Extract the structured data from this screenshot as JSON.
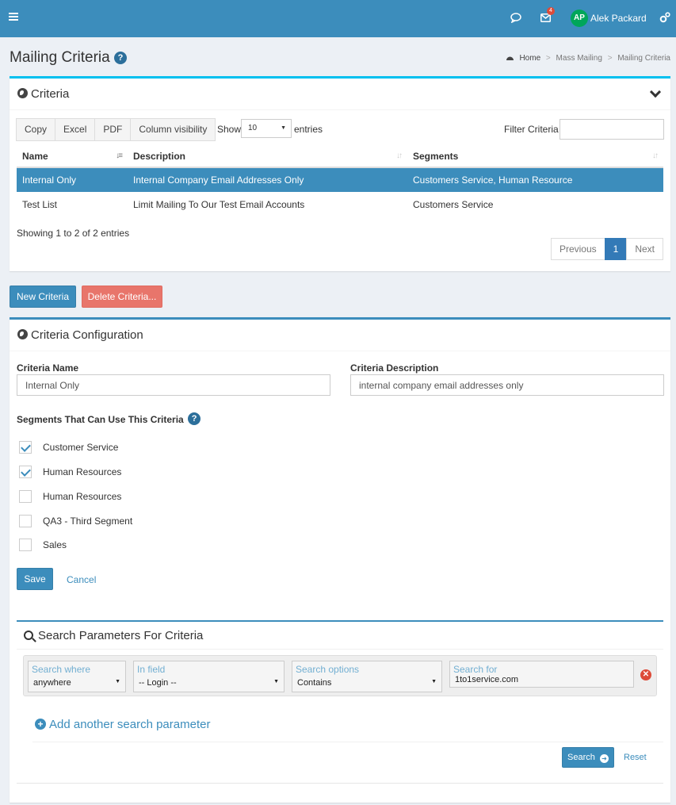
{
  "topbar": {
    "badge_count": "4",
    "avatar_initials": "AP",
    "user_name": "Alek Packard"
  },
  "page": {
    "title": "Mailing Criteria",
    "breadcrumb": [
      "Home",
      "Mass Mailing",
      "Mailing Criteria"
    ]
  },
  "criteria_box": {
    "title": "Criteria",
    "export_buttons": [
      "Copy",
      "Excel",
      "PDF",
      "Column visibility"
    ],
    "show_label": "Show",
    "page_length": "10",
    "entries_label": "entries",
    "filter_label": "Filter Criteria",
    "filter_value": "",
    "columns": [
      "Name",
      "Description",
      "Segments"
    ],
    "rows": [
      {
        "name": "Internal Only",
        "description": "Internal Company Email Addresses Only",
        "segments": "Customers Service, Human Resource",
        "selected": true
      },
      {
        "name": "Test List",
        "description": "Limit Mailing To Our Test Email Accounts",
        "segments": "Customers Service",
        "selected": false
      }
    ],
    "info": "Showing 1 to 2 of 2 entries",
    "pager": {
      "previous": "Previous",
      "current": "1",
      "next": "Next"
    }
  },
  "actions": {
    "new": "New Criteria",
    "delete": "Delete Criteria..."
  },
  "config": {
    "title": "Criteria Configuration",
    "name_label": "Criteria Name",
    "name_value": "Internal Only",
    "description_label": "Criteria Description",
    "description_value": "internal company email addresses only",
    "segments_label": "Segments That Can Use This Criteria",
    "segments": [
      {
        "label": "Customer Service",
        "checked": true
      },
      {
        "label": "Human Resources",
        "checked": true
      },
      {
        "label": "Human Resources",
        "checked": false
      },
      {
        "label": "QA3 - Third Segment",
        "checked": false
      },
      {
        "label": "Sales",
        "checked": false
      }
    ],
    "save": "Save",
    "cancel": "Cancel"
  },
  "search": {
    "title": "Search Parameters For Criteria",
    "where_label": "Search where",
    "where_value": "anywhere",
    "field_label": "In field",
    "field_value": "-- Login --",
    "options_label": "Search options",
    "options_value": "Contains",
    "for_label": "Search for",
    "for_value": "1to1service.com",
    "add_param": "Add another search parameter",
    "search_button": "Search",
    "reset": "Reset"
  },
  "colors": {
    "primary": "#3c8dbc",
    "danger": "#e8756b",
    "info": "#00c0ef",
    "success": "#00a65a"
  }
}
